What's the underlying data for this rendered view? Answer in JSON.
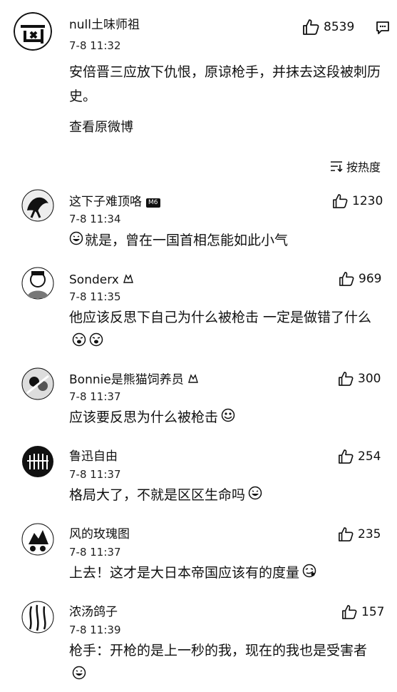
{
  "main_post": {
    "username": "null土味师祖",
    "time": "7-8 11:32",
    "likes": "8539",
    "text": "安倍晋三应放下仇恨，原谅枪手，并抹去这段被刺历史。",
    "view_original": "查看原微博"
  },
  "sort": {
    "label": "按热度"
  },
  "comments": [
    {
      "username": "这下子难顶咯",
      "badge": "M6",
      "time": "7-8 11:34",
      "likes": "1230",
      "text": "就是，曾在一国首相怎能如此小气",
      "emoji": [
        "grin-emoji"
      ]
    },
    {
      "username": "Sonderx",
      "time": "7-8 11:35",
      "likes": "969",
      "text": "他应该反思下自己为什么被枪击 一定是做错了什么",
      "emoji": [
        "laugh-emoji",
        "laugh-emoji"
      ]
    },
    {
      "username": "Bonnie是熊猫饲养员",
      "time": "7-8 11:37",
      "likes": "300",
      "text": "应该要反思为什么被枪击",
      "emoji": [
        "crazy-emoji"
      ]
    },
    {
      "username": "鲁迅自由",
      "time": "7-8 11:37",
      "likes": "254",
      "text": "格局大了，不就是区区生命吗",
      "emoji": [
        "grin-emoji"
      ]
    },
    {
      "username": "风的玫瑰图",
      "time": "7-8 11:37",
      "likes": "235",
      "text": "上去！这才是大日本帝国应该有的度量",
      "emoji": [
        "sly-emoji"
      ]
    },
    {
      "username": "浓汤鸽子",
      "time": "7-8 11:39",
      "likes": "157",
      "text": "枪手：开枪的是上一秒的我，现在的我也是受害者",
      "emoji": [
        "grin-emoji"
      ]
    }
  ]
}
